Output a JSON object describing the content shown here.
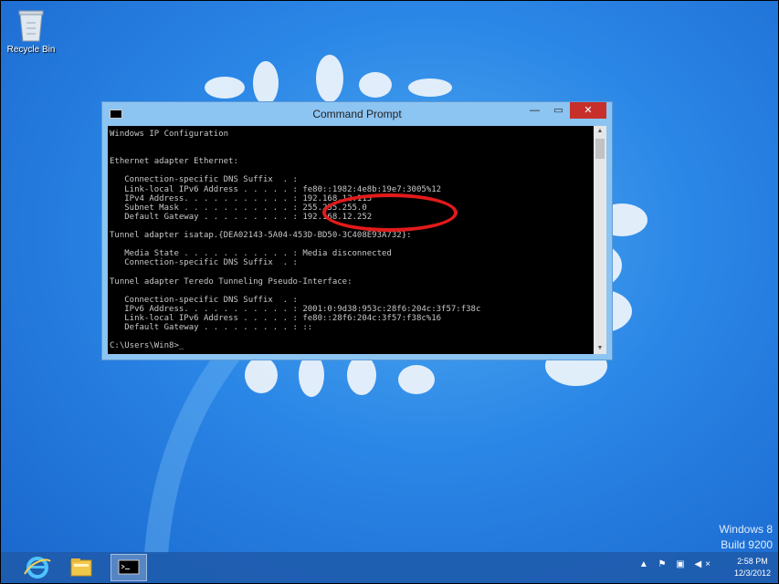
{
  "desktop": {
    "recycle_bin_label": "Recycle Bin",
    "watermark_line1": "Windows 8",
    "watermark_line2": "Build 9200"
  },
  "window": {
    "title": "Command Prompt",
    "min_glyph": "—",
    "max_glyph": "▭",
    "close_glyph": "✕",
    "console_text": "Windows IP Configuration\n\n\nEthernet adapter Ethernet:\n\n   Connection-specific DNS Suffix  . :\n   Link-local IPv6 Address . . . . . : fe80::1982:4e8b:19e7:3005%12\n   IPv4 Address. . . . . . . . . . . : 192.168.12.115\n   Subnet Mask . . . . . . . . . . . : 255.255.255.0\n   Default Gateway . . . . . . . . . : 192.168.12.252\n\nTunnel adapter isatap.{DEA02143-5A04-453D-BD50-3C408E93A732}:\n\n   Media State . . . . . . . . . . . : Media disconnected\n   Connection-specific DNS Suffix  . :\n\nTunnel adapter Teredo Tunneling Pseudo-Interface:\n\n   Connection-specific DNS Suffix  . :\n   IPv6 Address. . . . . . . . . . . : 2001:0:9d38:953c:28f6:204c:3f57:f38c\n   Link-local IPv6 Address . . . . . : fe80::28f6:204c:3f57:f38c%16\n   Default Gateway . . . . . . . . . : ::\n\nC:\\Users\\Win8>_"
  },
  "taskbar": {
    "tray_icons": "▲ ⚑ ▣ ◀×",
    "time": "2:58 PM",
    "date": "12/3/2012"
  },
  "icons": [
    "recycle-bin-icon",
    "internet-explorer-icon",
    "file-explorer-icon",
    "command-prompt-icon"
  ],
  "colors": {
    "close_button": "#c7302a",
    "highlight": "#e21a1a",
    "taskbar": "#1e5aaa"
  }
}
